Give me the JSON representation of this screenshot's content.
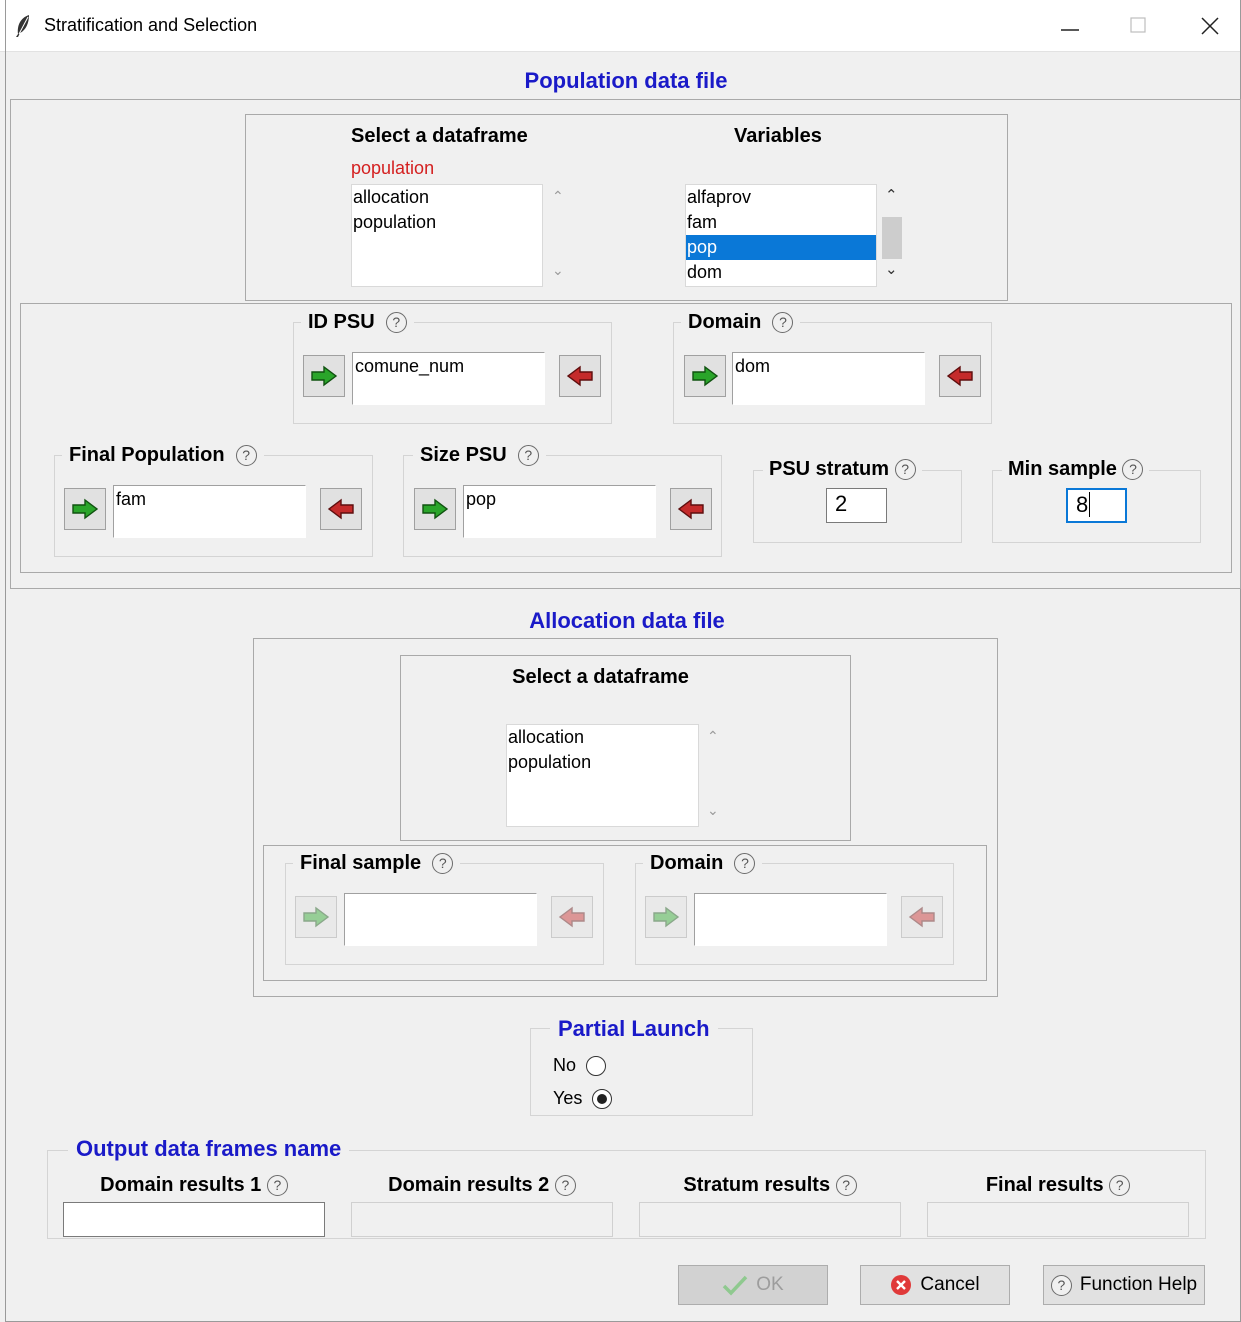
{
  "window": {
    "title": "Stratification and Selection",
    "minimize": "—",
    "maximize": "☐",
    "close": "✕"
  },
  "population": {
    "section_title": "Population data file",
    "select_dataframe_label": "Select a dataframe",
    "selected_dataframe": "population",
    "dataframes": [
      "allocation",
      "population"
    ],
    "variables_label": "Variables",
    "variables": [
      "alfaprov",
      "fam",
      "pop",
      "dom"
    ],
    "selected_variable": "pop",
    "id_psu": {
      "label": "ID PSU",
      "value": "comune_num"
    },
    "domain": {
      "label": "Domain",
      "value": "dom"
    },
    "final_population": {
      "label": "Final Population",
      "value": "fam"
    },
    "size_psu": {
      "label": "Size PSU",
      "value": "pop"
    },
    "psu_stratum": {
      "label": "PSU stratum",
      "value": "2"
    },
    "min_sample": {
      "label": "Min sample",
      "value": "8"
    }
  },
  "allocation": {
    "section_title": "Allocation data file",
    "select_dataframe_label": "Select a dataframe",
    "dataframes": [
      "allocation",
      "population"
    ],
    "final_sample": {
      "label": "Final sample",
      "value": ""
    },
    "domain": {
      "label": "Domain",
      "value": ""
    }
  },
  "partial_launch": {
    "title": "Partial Launch",
    "options": [
      "No",
      "Yes"
    ],
    "selected": "Yes"
  },
  "output": {
    "title": "Output data frames name",
    "fields": [
      "Domain results 1",
      "Domain results 2",
      "Stratum results",
      "Final results"
    ]
  },
  "buttons": {
    "ok": "OK",
    "cancel": "Cancel",
    "help": "Function Help"
  },
  "help_glyph": "?"
}
